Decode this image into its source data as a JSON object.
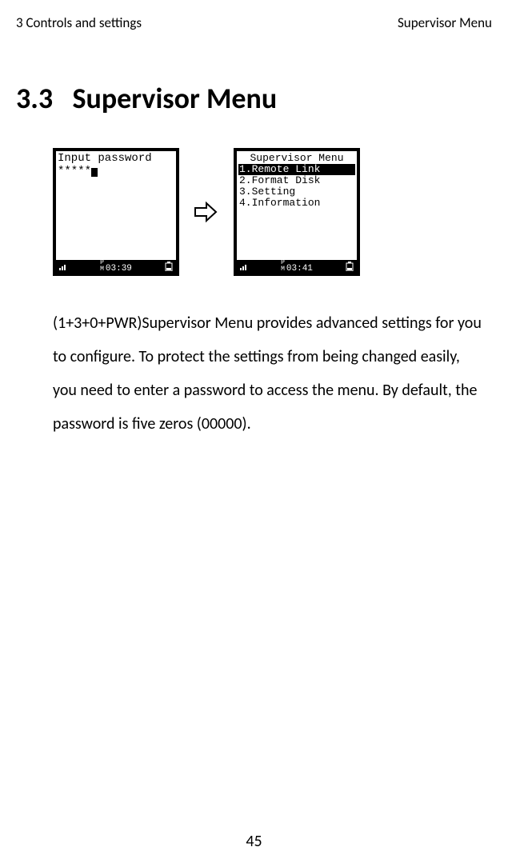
{
  "header": {
    "left": "3 Controls and settings",
    "right": "Supervisor Menu"
  },
  "section": {
    "number": "3.3",
    "title": "Supervisor Menu"
  },
  "screen1": {
    "prompt": "Input password",
    "masked": "*****",
    "status_time": "03:39",
    "status_pm": "P\nM"
  },
  "screen2": {
    "title": "Supervisor Menu",
    "items": [
      "1.Remote Link",
      "2.Format Disk",
      "3.Setting",
      "4.Information"
    ],
    "status_time": "03:41",
    "status_pm": "P\nM"
  },
  "body": {
    "text": "(1+3+0+PWR)Supervisor Menu provides advanced settings for you to configure. To protect the settings from being changed easily, you need to enter a password to access the menu. By default, the password is five zeros (00000)."
  },
  "page_number": "45"
}
